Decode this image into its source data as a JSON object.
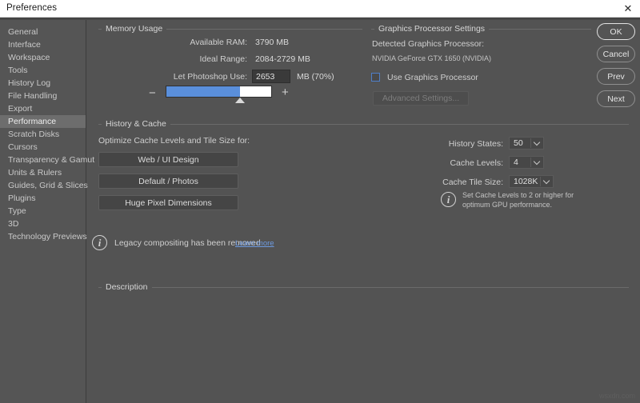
{
  "window": {
    "title": "Preferences",
    "close_icon": "close-icon"
  },
  "sidebar": {
    "items": [
      {
        "label": "General",
        "selected": false
      },
      {
        "label": "Interface",
        "selected": false
      },
      {
        "label": "Workspace",
        "selected": false
      },
      {
        "label": "Tools",
        "selected": false
      },
      {
        "label": "History Log",
        "selected": false
      },
      {
        "label": "File Handling",
        "selected": false
      },
      {
        "label": "Export",
        "selected": false
      },
      {
        "label": "Performance",
        "selected": true
      },
      {
        "label": "Scratch Disks",
        "selected": false
      },
      {
        "label": "Cursors",
        "selected": false
      },
      {
        "label": "Transparency & Gamut",
        "selected": false
      },
      {
        "label": "Units & Rulers",
        "selected": false
      },
      {
        "label": "Guides, Grid & Slices",
        "selected": false
      },
      {
        "label": "Plugins",
        "selected": false
      },
      {
        "label": "Type",
        "selected": false
      },
      {
        "label": "3D",
        "selected": false
      },
      {
        "label": "Technology Previews",
        "selected": false
      }
    ]
  },
  "memory_usage": {
    "group_title": "Memory Usage",
    "available_ram_label": "Available RAM:",
    "available_ram_value": "3790 MB",
    "ideal_range_label": "Ideal Range:",
    "ideal_range_value": "2084-2729 MB",
    "let_photoshop_use_label": "Let Photoshop Use:",
    "let_photoshop_use_value": "2653",
    "unit_suffix": "MB (70%)",
    "slider": {
      "minus_label": "−",
      "plus_label": "+",
      "percent": 70
    }
  },
  "graphics": {
    "group_title": "Graphics Processor Settings",
    "detected_label": "Detected Graphics Processor:",
    "detected_value": "NVIDIA GeForce GTX 1650 (NVIDIA)",
    "use_gpu_label": "Use Graphics Processor",
    "use_gpu_checked": false,
    "advanced_button": "Advanced Settings...",
    "advanced_disabled": true
  },
  "history_cache": {
    "group_title": "History & Cache",
    "optimize_label": "Optimize Cache Levels and Tile Size for:",
    "preset_buttons": [
      "Web / UI Design",
      "Default / Photos",
      "Huge Pixel Dimensions"
    ],
    "fields": [
      {
        "label": "History States:",
        "value": "50"
      },
      {
        "label": "Cache Levels:",
        "value": "4"
      },
      {
        "label": "Cache Tile Size:",
        "value": "1028K"
      }
    ],
    "hint_icon": "info-icon",
    "hint_line1": "Set Cache Levels to 2 or higher for",
    "hint_line2": "optimum GPU performance."
  },
  "notice": {
    "icon": "info-icon",
    "text": "Legacy compositing has been removed",
    "link": "Learn more"
  },
  "description": {
    "group_title": "Description"
  },
  "actions": {
    "buttons": [
      {
        "label": "OK",
        "primary": true
      },
      {
        "label": "Cancel",
        "primary": false
      },
      {
        "label": "Prev",
        "primary": false
      },
      {
        "label": "Next",
        "primary": false
      }
    ]
  },
  "watermark": "wsxdn.com"
}
